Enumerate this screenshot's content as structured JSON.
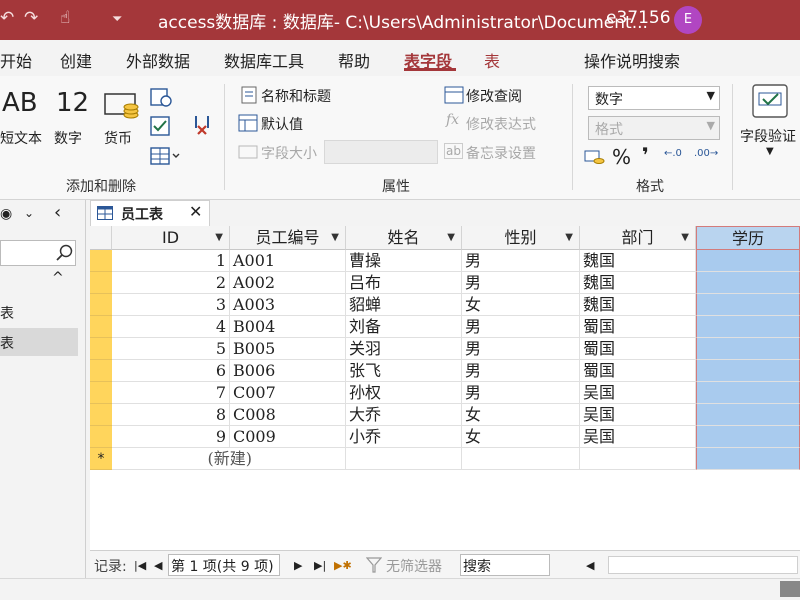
{
  "titlebar": {
    "title": "access数据库 : 数据库- C:\\Users\\Administrator\\Document...",
    "user_id": "e37156",
    "avatar_initial": "E",
    "qa_glyphs": [
      "↶",
      "↷",
      "☝",
      "⏷"
    ]
  },
  "menu": {
    "tabs": [
      "开始",
      "创建",
      "外部数据",
      "数据库工具",
      "帮助",
      "表字段",
      "表"
    ],
    "active": "表字段",
    "search_label": "操作说明搜索"
  },
  "ribbon": {
    "add_delete": {
      "items": [
        {
          "big": "AB",
          "label": "短文本"
        },
        {
          "big": "12",
          "label": "数字"
        },
        {
          "big": "",
          "label": "货币"
        }
      ],
      "group_label": "添加和删除"
    },
    "properties": {
      "name_caption": "名称和标题",
      "default_value": "默认值",
      "field_size": "字段大小",
      "modify_lookup": "修改查阅",
      "modify_expression": "修改表达式",
      "memo_settings": "备忘录设置",
      "group_label": "属性"
    },
    "format": {
      "data_type": "数字",
      "format": "格式",
      "group_label": "格式",
      "symbols": [
        "%",
        "❜",
        "←.0",
        ".00→"
      ]
    },
    "validation": {
      "label": "字段验证"
    }
  },
  "nav": {
    "items": [
      "表",
      "表"
    ]
  },
  "doctab": {
    "label": "员工表"
  },
  "table": {
    "headers": [
      "ID",
      "员工编号",
      "姓名",
      "性别",
      "部门",
      "学历"
    ],
    "rows": [
      {
        "id": "1",
        "code": "A001",
        "name": "曹操",
        "gender": "男",
        "dept": "魏国"
      },
      {
        "id": "2",
        "code": "A002",
        "name": "吕布",
        "gender": "男",
        "dept": "魏国"
      },
      {
        "id": "3",
        "code": "A003",
        "name": "貂蝉",
        "gender": "女",
        "dept": "魏国"
      },
      {
        "id": "4",
        "code": "B004",
        "name": "刘备",
        "gender": "男",
        "dept": "蜀国"
      },
      {
        "id": "5",
        "code": "B005",
        "name": "关羽",
        "gender": "男",
        "dept": "蜀国"
      },
      {
        "id": "6",
        "code": "B006",
        "name": "张飞",
        "gender": "男",
        "dept": "蜀国"
      },
      {
        "id": "7",
        "code": "C007",
        "name": "孙权",
        "gender": "男",
        "dept": "吴国"
      },
      {
        "id": "8",
        "code": "C008",
        "name": "大乔",
        "gender": "女",
        "dept": "吴国"
      },
      {
        "id": "9",
        "code": "C009",
        "name": "小乔",
        "gender": "女",
        "dept": "吴国"
      }
    ],
    "new_row_marker": "*",
    "new_row_label": "(新建)"
  },
  "recordbar": {
    "label": "记录:",
    "position": "第 1 项(共 9 项)",
    "filter": "无筛选器",
    "search": "搜索"
  },
  "colors": {
    "accent": "#a4373a",
    "selected_column": "#a9cbee",
    "row_selector": "#ffd55c"
  }
}
